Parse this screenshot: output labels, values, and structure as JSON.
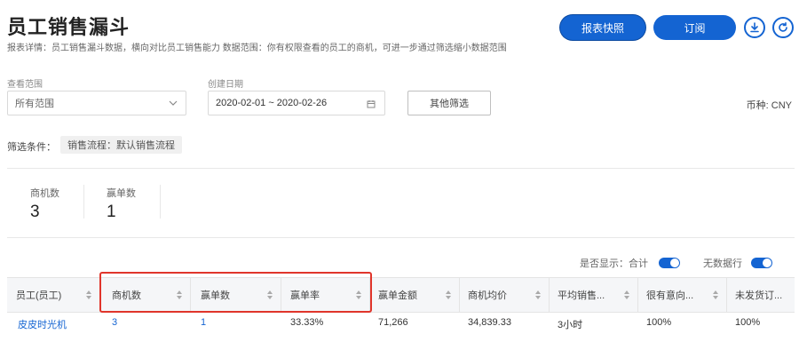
{
  "header": {
    "title": "员工销售漏斗",
    "subtitle": "报表详情：员工销售漏斗数据，横向对比员工销售能力 数据范围：你有权限查看的员工的商机，可进一步通过筛选缩小数据范围",
    "snapshot_label": "报表快照",
    "subscribe_label": "订阅"
  },
  "filters": {
    "scope_label": "查看范围",
    "scope_value": "所有范围",
    "date_label": "创建日期",
    "date_value": "2020-02-01 ~ 2020-02-26",
    "other_filter_label": "其他筛选",
    "currency": "币种: CNY",
    "condition_label": "筛选条件：",
    "condition_tag": "销售流程：默认销售流程"
  },
  "stats": [
    {
      "label": "商机数",
      "value": "3"
    },
    {
      "label": "赢单数",
      "value": "1"
    }
  ],
  "display_options": {
    "show_total_label": "是否显示：合计",
    "show_total_on": true,
    "no_data_rows_label": "无数据行",
    "no_data_rows_on": true
  },
  "table": {
    "columns": [
      "员工(员工)",
      "商机数",
      "赢单数",
      "赢单率",
      "赢单金额",
      "商机均价",
      "平均销售...",
      "很有意向...",
      "未发货订..."
    ],
    "rows": [
      [
        "皮皮时光机",
        "3",
        "1",
        "33.33%",
        "71,266",
        "34,839.33",
        "3小时",
        "100%",
        "100%"
      ]
    ]
  },
  "colors": {
    "primary": "#1464d2",
    "highlight": "#e0352b"
  }
}
